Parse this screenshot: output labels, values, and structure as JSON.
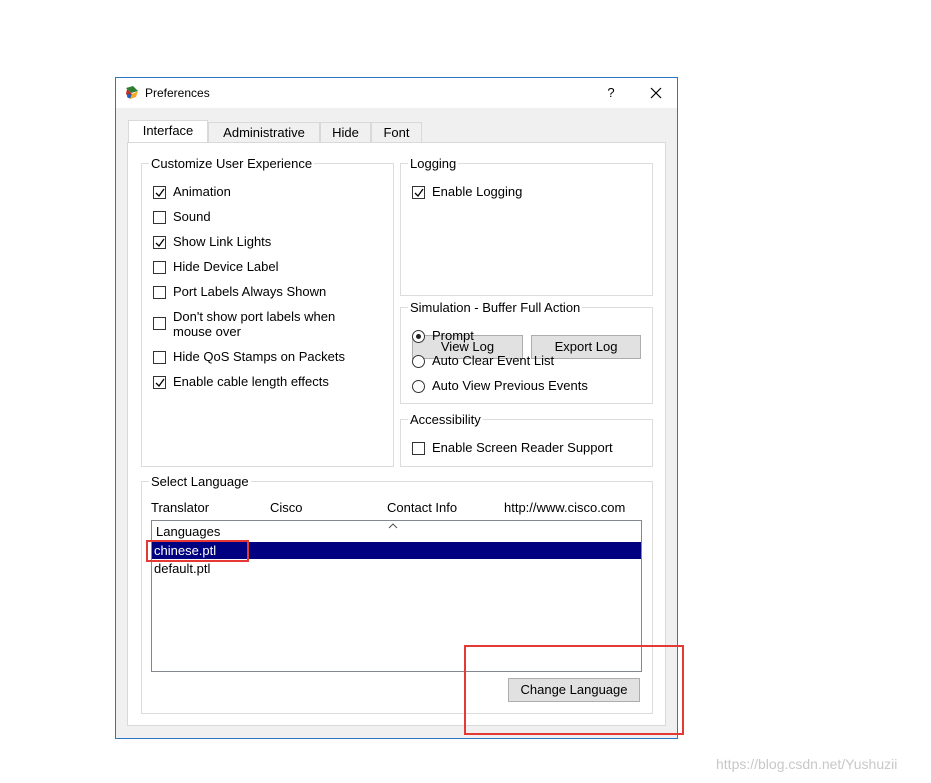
{
  "window": {
    "title": "Preferences",
    "help_label": "?",
    "close_label": "✕"
  },
  "tabs": [
    {
      "label": "Interface",
      "active": true
    },
    {
      "label": "Administrative",
      "active": false
    },
    {
      "label": "Hide",
      "active": false
    },
    {
      "label": "Font",
      "active": false
    }
  ],
  "customize": {
    "title": "Customize User Experience",
    "items": [
      {
        "label": "Animation",
        "checked": true
      },
      {
        "label": "Sound",
        "checked": false
      },
      {
        "label": "Show Link Lights",
        "checked": true
      },
      {
        "label": "Hide Device Label",
        "checked": false
      },
      {
        "label": "Port Labels Always Shown",
        "checked": false
      },
      {
        "label": "Don't show port labels when",
        "label2": "mouse over",
        "checked": false
      },
      {
        "label": "Hide QoS Stamps on Packets",
        "checked": false
      },
      {
        "label": "Enable cable length effects",
        "checked": true
      }
    ]
  },
  "logging": {
    "title": "Logging",
    "enable_label": "Enable Logging",
    "enable_checked": true,
    "view_log_label": "View Log",
    "export_log_label": "Export Log"
  },
  "simulation": {
    "title": "Simulation - Buffer Full Action",
    "options": [
      {
        "label": "Prompt",
        "selected": true
      },
      {
        "label": "Auto Clear Event List",
        "selected": false
      },
      {
        "label": "Auto View Previous Events",
        "selected": false
      }
    ]
  },
  "accessibility": {
    "title": "Accessibility",
    "screen_reader_label": "Enable Screen Reader Support",
    "screen_reader_checked": false
  },
  "language": {
    "title": "Select Language",
    "translator_label": "Translator",
    "translator_value": "Cisco",
    "contact_label": "Contact Info",
    "contact_value": "http://www.cisco.com",
    "list_header": "Languages",
    "items": [
      "chinese.ptl",
      "default.ptl"
    ],
    "selected_index": 0,
    "change_button_label": "Change Language"
  },
  "watermark": "https://blog.csdn.net/Yushuzii",
  "colors": {
    "selection": "#000080",
    "highlight_box": "#e53935",
    "window_border": "#2b76c7"
  }
}
